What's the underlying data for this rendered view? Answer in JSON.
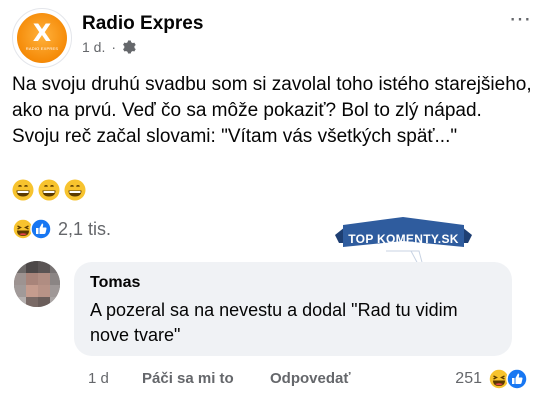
{
  "post": {
    "page_name": "Radio Expres",
    "time": "1 d.",
    "separator": "·",
    "more_icon": "⋯",
    "text": "Na svoju druhú svadbu som si zavolal toho istého starejšieho, ako na prvú. Veď čo sa môže pokaziť? Bol to zlý nápad. Svoju reč začal slovami: \"Vítam vás všetkých späť...\"",
    "emojis": [
      "grinning-face",
      "grinning-face",
      "grinning-face"
    ],
    "reactions": {
      "icons": [
        "haha",
        "like"
      ],
      "count": "2,1 tis."
    },
    "logo": {
      "letter": "X",
      "caption": "RADIO EXPRES"
    },
    "accent_color": "#f58a07"
  },
  "watermark": {
    "text": "TOP KOMENTY.SK",
    "color": "#2f5c9e"
  },
  "comment": {
    "author": "Tomas",
    "text": "A pozeral sa na nevestu a dodal \"Rad tu vidim nove tvare\"",
    "time": "1 d",
    "like_label": "Páči sa mi to",
    "reply_label": "Odpovedať",
    "reaction_count": "251",
    "reaction_icons": [
      "haha",
      "like"
    ]
  },
  "colors": {
    "like_blue": "#1877f2",
    "haha_yellow": "#f7c32e",
    "secondary_text": "#65676b",
    "bubble_bg": "#f0f2f5"
  }
}
